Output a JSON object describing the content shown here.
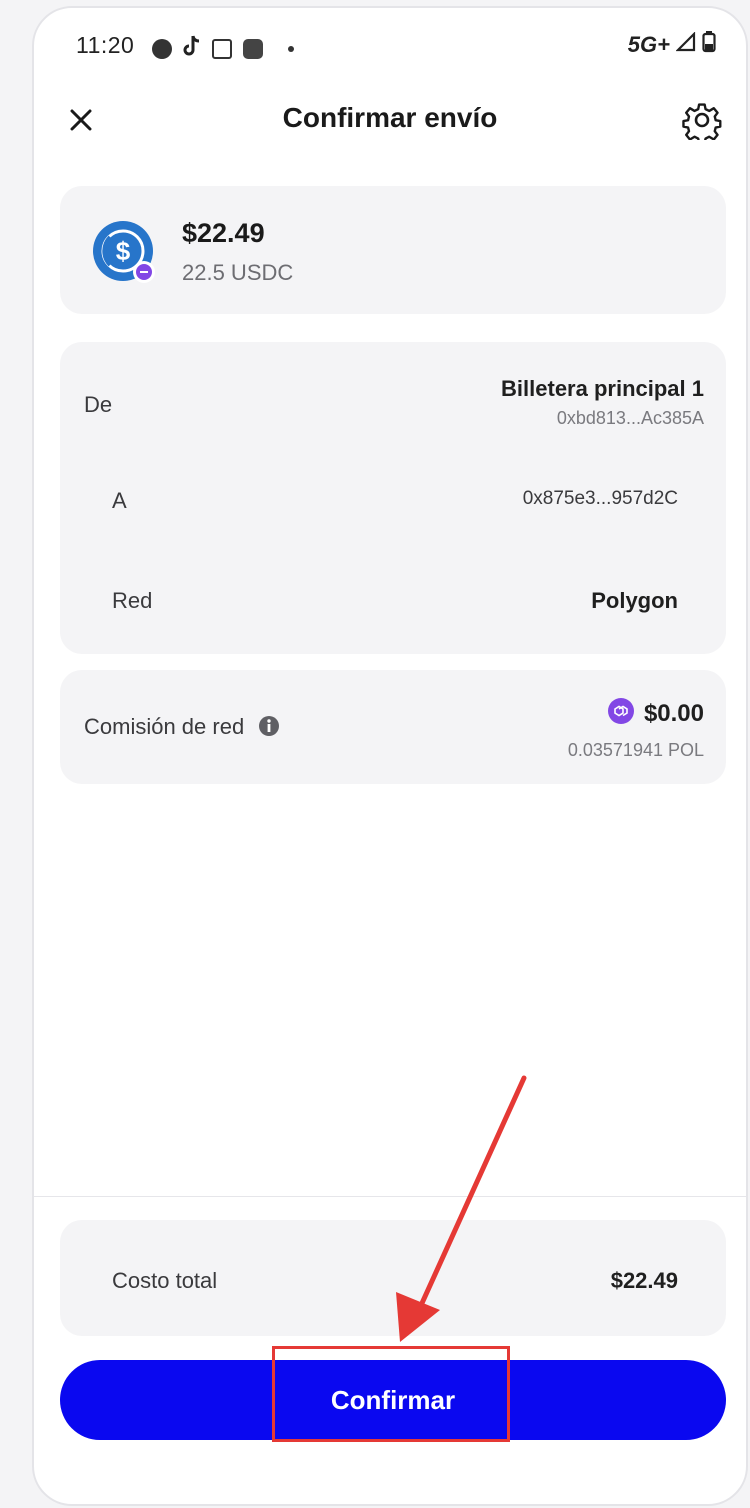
{
  "status_bar": {
    "time": "11:20",
    "network": "5G+",
    "icons": [
      "notification-icon",
      "tiktok-icon",
      "cast-icon",
      "app-icon",
      "dot-icon",
      "signal-icon",
      "battery-icon"
    ]
  },
  "header": {
    "title": "Confirmar envío",
    "close_icon": "close-icon",
    "settings_icon": "gear-icon"
  },
  "asset": {
    "amount": "$22.49",
    "amount_token": "22.5 USDC",
    "icon": "usdc-icon",
    "colors": {
      "usdc": "#2775ca",
      "polygon": "#8247e5"
    }
  },
  "details": {
    "from_label": "De",
    "from_wallet": "Billetera principal 1",
    "from_address": "0xbd813...Ac385A",
    "to_label": "A",
    "to_address": "0x875e3...957d2C",
    "network_label": "Red",
    "network_value": "Polygon"
  },
  "fee": {
    "label": "Comisión de red",
    "amount": "$0.00",
    "amount_token": "0.03571941 POL",
    "info_icon": "info-icon"
  },
  "total": {
    "label": "Costo total",
    "value": "$22.49"
  },
  "actions": {
    "confirm_label": "Confirmar",
    "confirm_color": "#0a08f0"
  },
  "annotation": {
    "highlight_color": "#e53935"
  }
}
